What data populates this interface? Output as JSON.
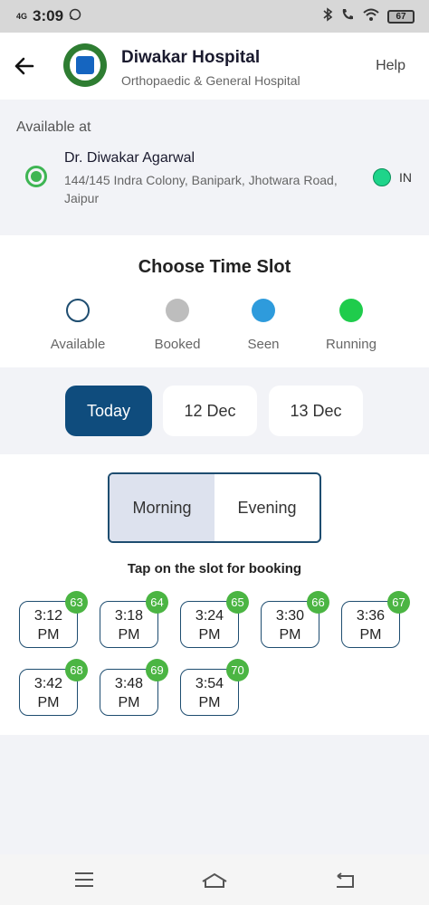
{
  "status_bar": {
    "network": "4G",
    "time": "3:09",
    "battery": "67"
  },
  "header": {
    "title": "Diwakar Hospital",
    "subtitle": "Orthopaedic & General Hospital",
    "help": "Help"
  },
  "availability": {
    "label": "Available at",
    "doctor_name": "Dr. Diwakar Agarwal",
    "address": "144/145 Indra Colony, Banipark, Jhotwara Road, Jaipur",
    "status": "IN",
    "status_color": "#1ed48a"
  },
  "time_slot": {
    "title": "Choose Time Slot",
    "legend": [
      {
        "label": "Available",
        "color": "#ffffff"
      },
      {
        "label": "Booked",
        "color": "#bdbdbd"
      },
      {
        "label": "Seen",
        "color": "#2e9bdc"
      },
      {
        "label": "Running",
        "color": "#1fcc4c"
      }
    ]
  },
  "dates": [
    {
      "label": "Today",
      "selected": true
    },
    {
      "label": "12 Dec",
      "selected": false
    },
    {
      "label": "13 Dec",
      "selected": false
    }
  ],
  "session": {
    "options": [
      "Morning",
      "Evening"
    ],
    "selected": "Morning"
  },
  "instruction": "Tap on the slot for booking",
  "slots": [
    {
      "time": "3:12",
      "period": "PM",
      "number": "63"
    },
    {
      "time": "3:18",
      "period": "PM",
      "number": "64"
    },
    {
      "time": "3:24",
      "period": "PM",
      "number": "65"
    },
    {
      "time": "3:30",
      "period": "PM",
      "number": "66"
    },
    {
      "time": "3:36",
      "period": "PM",
      "number": "67"
    },
    {
      "time": "3:42",
      "period": "PM",
      "number": "68"
    },
    {
      "time": "3:48",
      "period": "PM",
      "number": "69"
    },
    {
      "time": "3:54",
      "period": "PM",
      "number": "70"
    }
  ],
  "colors": {
    "primary": "#0f4c7d",
    "badge": "#4bb543",
    "accent_green": "#3eb553"
  }
}
